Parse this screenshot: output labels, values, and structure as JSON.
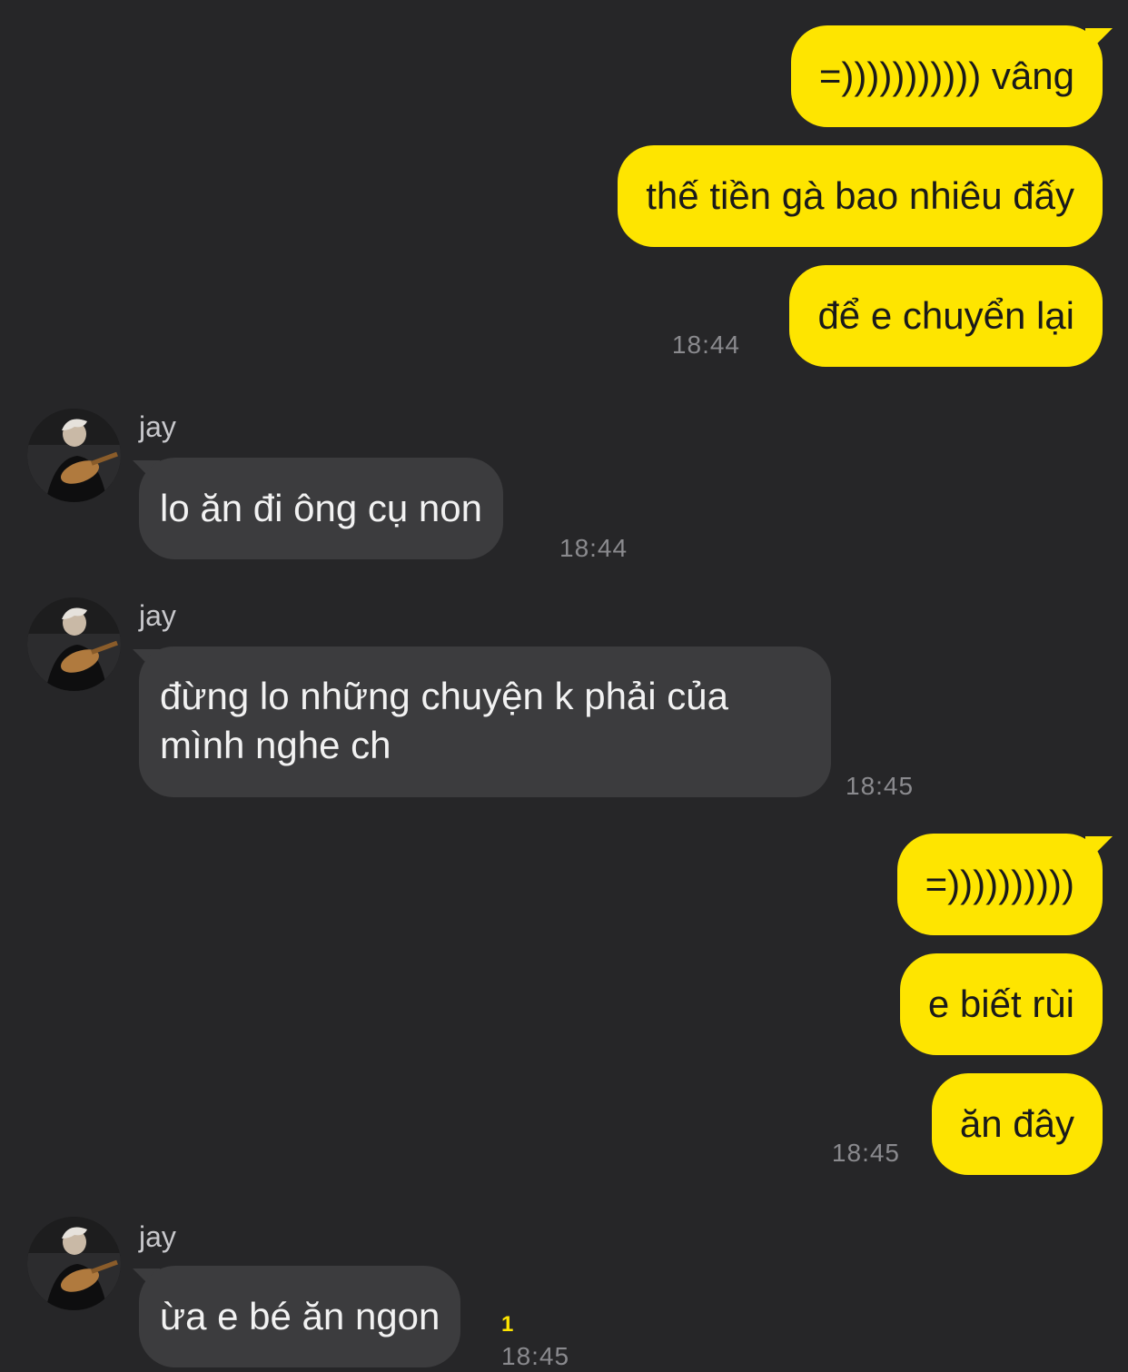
{
  "contact": {
    "name": "jay"
  },
  "messages": [
    {
      "side": "out",
      "text": "=))))))))))) vâng"
    },
    {
      "side": "out",
      "text": "thế tiền gà bao nhiêu đấy"
    },
    {
      "side": "out",
      "text": "để e chuyển lại",
      "time": "18:44"
    },
    {
      "side": "in",
      "sender": "jay",
      "text": "lo ăn đi ông cụ non",
      "time": "18:44"
    },
    {
      "side": "in",
      "sender": "jay",
      "lines": [
        "đừng lo những chuyện k phải của",
        "mình nghe ch"
      ],
      "time": "18:45"
    },
    {
      "side": "out",
      "text": "=))))))))))"
    },
    {
      "side": "out",
      "text": "e biết rùi"
    },
    {
      "side": "out",
      "text": "ăn đây",
      "time": "18:45"
    },
    {
      "side": "in",
      "sender": "jay",
      "text": "ừa e bé ăn ngon",
      "time": "18:45",
      "unread": "1"
    }
  ],
  "colors": {
    "background": "#262628",
    "outgoing_bubble": "#FEE500",
    "incoming_bubble": "#3c3c3e",
    "timestamp": "#8a8a8e",
    "unread": "#FEE500"
  },
  "icons": {
    "avatar": "avatar-photo-icon"
  }
}
